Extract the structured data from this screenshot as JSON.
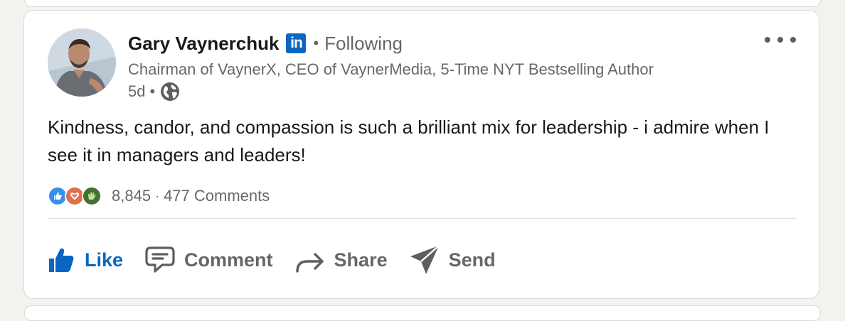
{
  "post": {
    "author": {
      "name": "Gary Vaynerchuk",
      "badge_text": "in",
      "badge_icon": "linkedin-icon",
      "separator": "•",
      "follow_status": "Following",
      "headline": "Chairman of VaynerX, CEO of VaynerMedia, 5-Time NYT Bestselling Author"
    },
    "meta": {
      "time": "5d",
      "separator": "•",
      "visibility_icon": "globe-icon"
    },
    "text": "Kindness, candor, and compassion is such a brilliant mix for leadership - i admire when I see it in managers and leaders!",
    "reactions": {
      "types": [
        "like",
        "love",
        "celebrate"
      ],
      "count": "8,845",
      "separator": "·",
      "comments": "477 Comments"
    },
    "actions": {
      "like": "Like",
      "comment": "Comment",
      "share": "Share",
      "send": "Send"
    }
  },
  "colors": {
    "linkedin_blue": "#0a66c2",
    "like_reaction": "#378fe9",
    "love_reaction": "#df704d",
    "celebrate_reaction": "#44712e",
    "background": "#f3f2ef"
  }
}
